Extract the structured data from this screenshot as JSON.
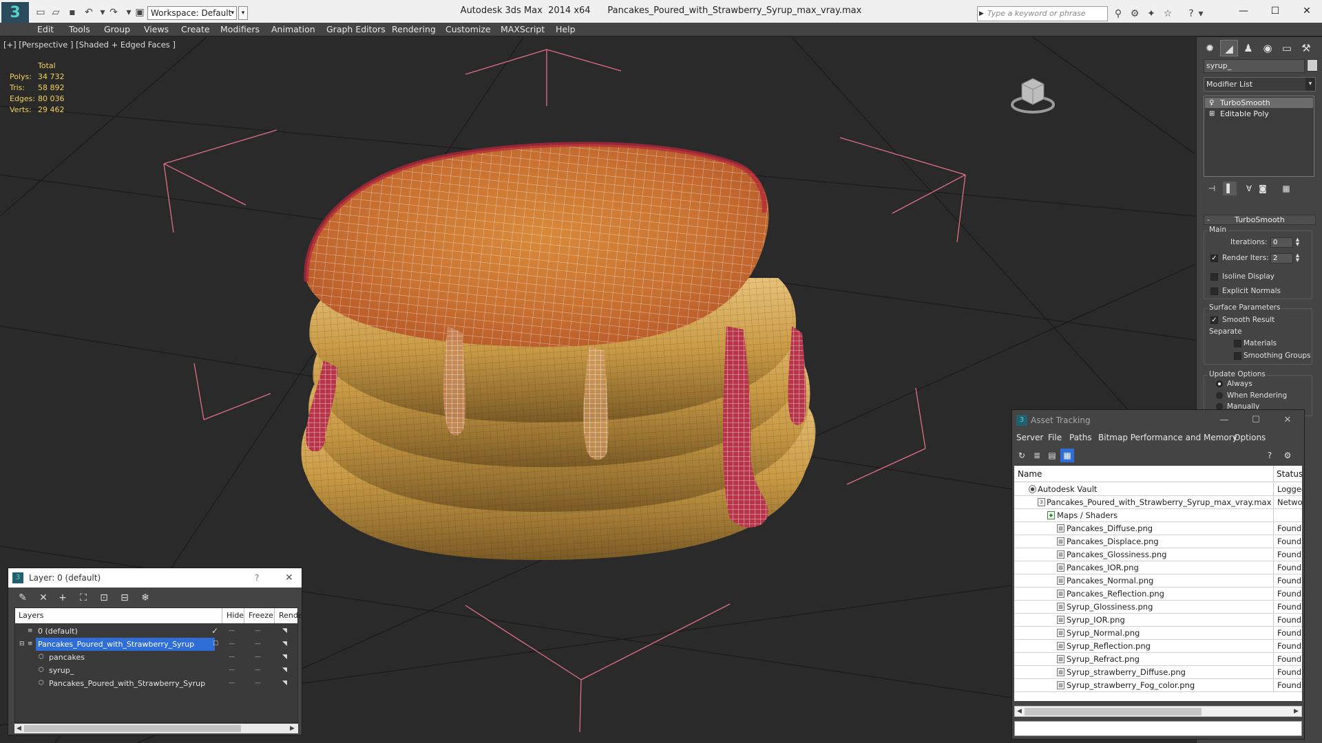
{
  "window": {
    "title": "Autodesk 3ds Max  2014 x64      Pancakes_Poured_with_Strawberry_Syrup_max_vray.max",
    "workspace": "Workspace: Default",
    "search_placeholder": "Type a keyword or phrase",
    "app_logo": "3"
  },
  "menu": [
    "Edit",
    "Tools",
    "Group",
    "Views",
    "Create",
    "Modifiers",
    "Animation",
    "Graph Editors",
    "Rendering",
    "Customize",
    "MAXScript",
    "Help"
  ],
  "viewport": {
    "label": "[+] [Perspective ] [Shaded + Edged Faces ]",
    "stats": {
      "header": "Total",
      "rows": [
        {
          "k": "Polys:",
          "v": "34 732"
        },
        {
          "k": "Tris:",
          "v": "58 892"
        },
        {
          "k": "Edges:",
          "v": "80 036"
        },
        {
          "k": "Verts:",
          "v": "29 462"
        }
      ]
    }
  },
  "command_panel": {
    "object_name": "syrup_",
    "modifier_list": "Modifier List",
    "stack": [
      "TurboSmooth",
      "Editable Poly"
    ],
    "rollout_title": "TurboSmooth",
    "main_group": "Main",
    "iterations_label": "Iterations:",
    "iterations_value": "0",
    "render_iters_label": "Render Iters:",
    "render_iters_value": "2",
    "isoline_display": "Isoline Display",
    "explicit_normals": "Explicit Normals",
    "surface_group": "Surface Parameters",
    "smooth_result": "Smooth Result",
    "separate": "Separate",
    "materials": "Materials",
    "smoothing_groups": "Smoothing Groups",
    "update_group": "Update Options",
    "always": "Always",
    "when_rendering": "When Rendering",
    "manually": "Manually"
  },
  "layer_window": {
    "title": "Layer: 0 (default)",
    "help": "?",
    "close": "✕",
    "columns": [
      "Layers",
      "Hide",
      "Freeze",
      "Rende"
    ],
    "rows": [
      {
        "name": "0 (default)"
      },
      {
        "name": "Pancakes_Poured_with_Strawberry_Syrup"
      },
      {
        "name": "pancakes"
      },
      {
        "name": "syrup_"
      },
      {
        "name": "Pancakes_Poured_with_Strawberry_Syrup"
      }
    ]
  },
  "asset_window": {
    "title": "Asset Tracking",
    "menu": [
      "Server",
      "File",
      "Paths",
      "Bitmap Performance and Memory",
      "Options"
    ],
    "columns": [
      "Name",
      "Status"
    ],
    "rows": [
      {
        "name": "Autodesk Vault",
        "status": "Logged"
      },
      {
        "name": "Pancakes_Poured_with_Strawberry_Syrup_max_vray.max",
        "status": "Networ"
      },
      {
        "name": "Maps / Shaders",
        "status": ""
      },
      {
        "name": "Pancakes_Diffuse.png",
        "status": "Found"
      },
      {
        "name": "Pancakes_Displace.png",
        "status": "Found"
      },
      {
        "name": "Pancakes_Glossiness.png",
        "status": "Found"
      },
      {
        "name": "Pancakes_IOR.png",
        "status": "Found"
      },
      {
        "name": "Pancakes_Normal.png",
        "status": "Found"
      },
      {
        "name": "Pancakes_Reflection.png",
        "status": "Found"
      },
      {
        "name": "Syrup_Glossiness.png",
        "status": "Found"
      },
      {
        "name": "Syrup_IOR.png",
        "status": "Found"
      },
      {
        "name": "Syrup_Normal.png",
        "status": "Found"
      },
      {
        "name": "Syrup_Reflection.png",
        "status": "Found"
      },
      {
        "name": "Syrup_Refract.png",
        "status": "Found"
      },
      {
        "name": "Syrup_strawberry_Diffuse.png",
        "status": "Found"
      },
      {
        "name": "Syrup_strawberry_Fog_color.png",
        "status": "Found"
      }
    ]
  }
}
